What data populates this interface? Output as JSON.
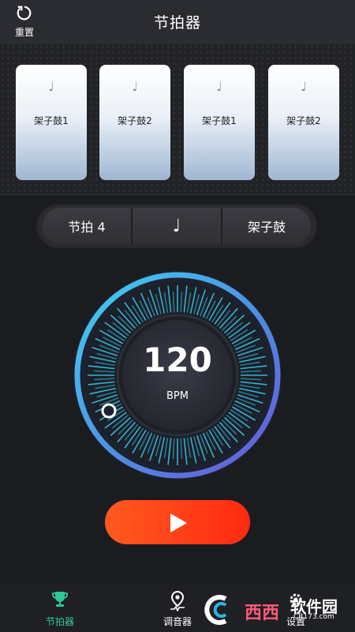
{
  "header": {
    "reset_label": "重置",
    "title": "节拍器"
  },
  "pads": [
    {
      "note": "♩",
      "label": "架子鼓1"
    },
    {
      "note": "♩",
      "label": "架子鼓2"
    },
    {
      "note": "♩",
      "label": "架子鼓1"
    },
    {
      "note": "♩",
      "label": "架子鼓2"
    }
  ],
  "controls": {
    "beat": "节拍 4",
    "note": "♩",
    "sound": "架子鼓"
  },
  "tempo": {
    "value": "120",
    "unit": "BPM"
  },
  "tabs": [
    {
      "label": "节拍器",
      "active": true
    },
    {
      "label": "调音器",
      "active": false
    },
    {
      "label": "设置",
      "active": false
    }
  ],
  "watermark": {
    "brand": "西西",
    "name": "软件园",
    "url": "CR173.com"
  },
  "colors": {
    "accent_green": "#2fc79a",
    "play_red": "#ff3a15",
    "dial_cyan": "#3cc7ee"
  }
}
